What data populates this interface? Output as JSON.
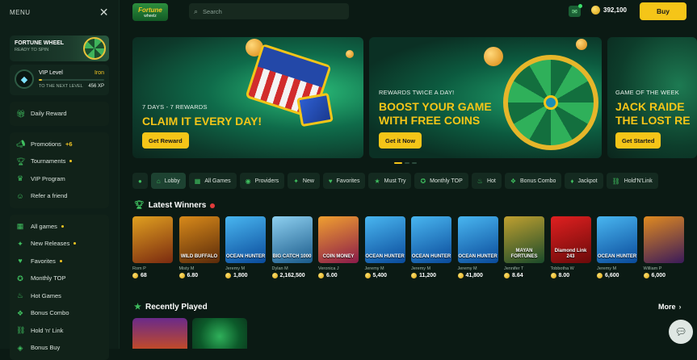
{
  "sidebar": {
    "menu_label": "MENU",
    "close_icon": "close-icon",
    "wheel_card": {
      "title": "FORTUNE WHEEL",
      "subtitle": "READY TO SPIN"
    },
    "vip": {
      "label": "VIP Level",
      "level": "Iron",
      "next_label": "TO THE NEXT LEVEL",
      "xp": "456 XP",
      "progress": 0.05
    },
    "group1": [
      {
        "label": "Daily Reward",
        "icon": "gift-icon"
      }
    ],
    "group2": [
      {
        "label": "Promotions",
        "icon": "megaphone-icon",
        "badge": "+6"
      },
      {
        "label": "Tournaments",
        "icon": "trophy-icon",
        "dot": true
      },
      {
        "label": "VIP Program",
        "icon": "crown-icon"
      },
      {
        "label": "Refer a friend",
        "icon": "user-plus-icon"
      }
    ],
    "group3": [
      {
        "label": "All games",
        "icon": "grid-icon",
        "dot": true
      },
      {
        "label": "New Releases",
        "icon": "new-icon",
        "dot": true
      },
      {
        "label": "Favorites",
        "icon": "heart-icon",
        "dot": true
      },
      {
        "label": "Monthly TOP",
        "icon": "medal-icon"
      },
      {
        "label": "Hot Games",
        "icon": "fire-icon"
      },
      {
        "label": "Bonus Combo",
        "icon": "combo-icon"
      },
      {
        "label": "Hold 'n' Link",
        "icon": "link-icon"
      },
      {
        "label": "Bonus Buy",
        "icon": "cart-icon"
      }
    ]
  },
  "header": {
    "logo": {
      "line1": "Fortune",
      "line2": "wheelz"
    },
    "search_placeholder": "Search",
    "coins": "392,100",
    "buy_label": "Buy"
  },
  "banners": [
    {
      "subtitle": "7 DAYS - 7 REWARDS",
      "title": "CLAIM IT EVERY DAY!",
      "button": "Get Reward"
    },
    {
      "subtitle": "REWARDS TWICE A DAY!",
      "title_line1": "BOOST YOUR GAME",
      "title_line2": "WITH FREE COINS",
      "button": "Get it Now"
    },
    {
      "subtitle": "GAME OF THE WEEK",
      "title_line1": "JACK RAIDE",
      "title_line2": "THE LOST RE",
      "button": "Get Started"
    }
  ],
  "chips": [
    {
      "label": "",
      "icon": "circle-icon"
    },
    {
      "label": "Lobby",
      "icon": "home-icon",
      "selected": true
    },
    {
      "label": "All Games",
      "icon": "grid-icon"
    },
    {
      "label": "Providers",
      "icon": "provider-icon"
    },
    {
      "label": "New",
      "icon": "new-icon"
    },
    {
      "label": "Favorites",
      "icon": "heart-icon"
    },
    {
      "label": "Must Try",
      "icon": "star-icon"
    },
    {
      "label": "Monthly TOP",
      "icon": "medal-icon"
    },
    {
      "label": "Hot",
      "icon": "fire-icon"
    },
    {
      "label": "Bonus Combo",
      "icon": "combo-icon"
    },
    {
      "label": "Jackpot",
      "icon": "jackpot-icon"
    },
    {
      "label": "Hold'N'Link",
      "icon": "link-icon"
    }
  ],
  "latest_winners": {
    "title": "Latest Winners",
    "items": [
      {
        "name": "Rom P",
        "amount": "68",
        "game": "",
        "c1": "#7a2a10",
        "c2": "#e0a020"
      },
      {
        "name": "Misty M",
        "amount": "6.80",
        "game": "WILD BUFFALO",
        "c1": "#5a2a0a",
        "c2": "#d88a1a"
      },
      {
        "name": "Jeremy M",
        "amount": "1,800",
        "game": "OCEAN HUNTER",
        "c1": "#0a4a9a",
        "c2": "#49b6f0"
      },
      {
        "name": "Dylan M",
        "amount": "2,162,500",
        "game": "BIG CATCH 1000",
        "c1": "#1a5a8a",
        "c2": "#8ed0f0"
      },
      {
        "name": "Veronica J",
        "amount": "6.00",
        "game": "COIN MONEY",
        "c1": "#8a1a4a",
        "c2": "#f0a030"
      },
      {
        "name": "Jeremy M",
        "amount": "5,400",
        "game": "OCEAN HUNTER",
        "c1": "#0a4a9a",
        "c2": "#49b6f0"
      },
      {
        "name": "Jeremy M",
        "amount": "11,200",
        "game": "OCEAN HUNTER",
        "c1": "#0a4a9a",
        "c2": "#49b6f0"
      },
      {
        "name": "Jeremy M",
        "amount": "41,800",
        "game": "OCEAN HUNTER",
        "c1": "#0a4a9a",
        "c2": "#49b6f0"
      },
      {
        "name": "Jennifer T",
        "amount": "8.64",
        "game": "MAYAN FORTUNES",
        "c1": "#1a4a2a",
        "c2": "#c0a030"
      },
      {
        "name": "Tobbotha W",
        "amount": "8.00",
        "game": "Diamond Link 243",
        "c1": "#6a0a0a",
        "c2": "#e02020"
      },
      {
        "name": "Jeremy M",
        "amount": "6,600",
        "game": "OCEAN HUNTER",
        "c1": "#0a4a9a",
        "c2": "#49b6f0"
      },
      {
        "name": "William P",
        "amount": "6,000",
        "game": "",
        "c1": "#3a1a5a",
        "c2": "#e08a20"
      }
    ]
  },
  "recently_played": {
    "title": "Recently Played",
    "more": "More"
  },
  "colors": {
    "accent": "#f5c518",
    "green": "#3fbf5f",
    "bg": "#0b1a14"
  }
}
